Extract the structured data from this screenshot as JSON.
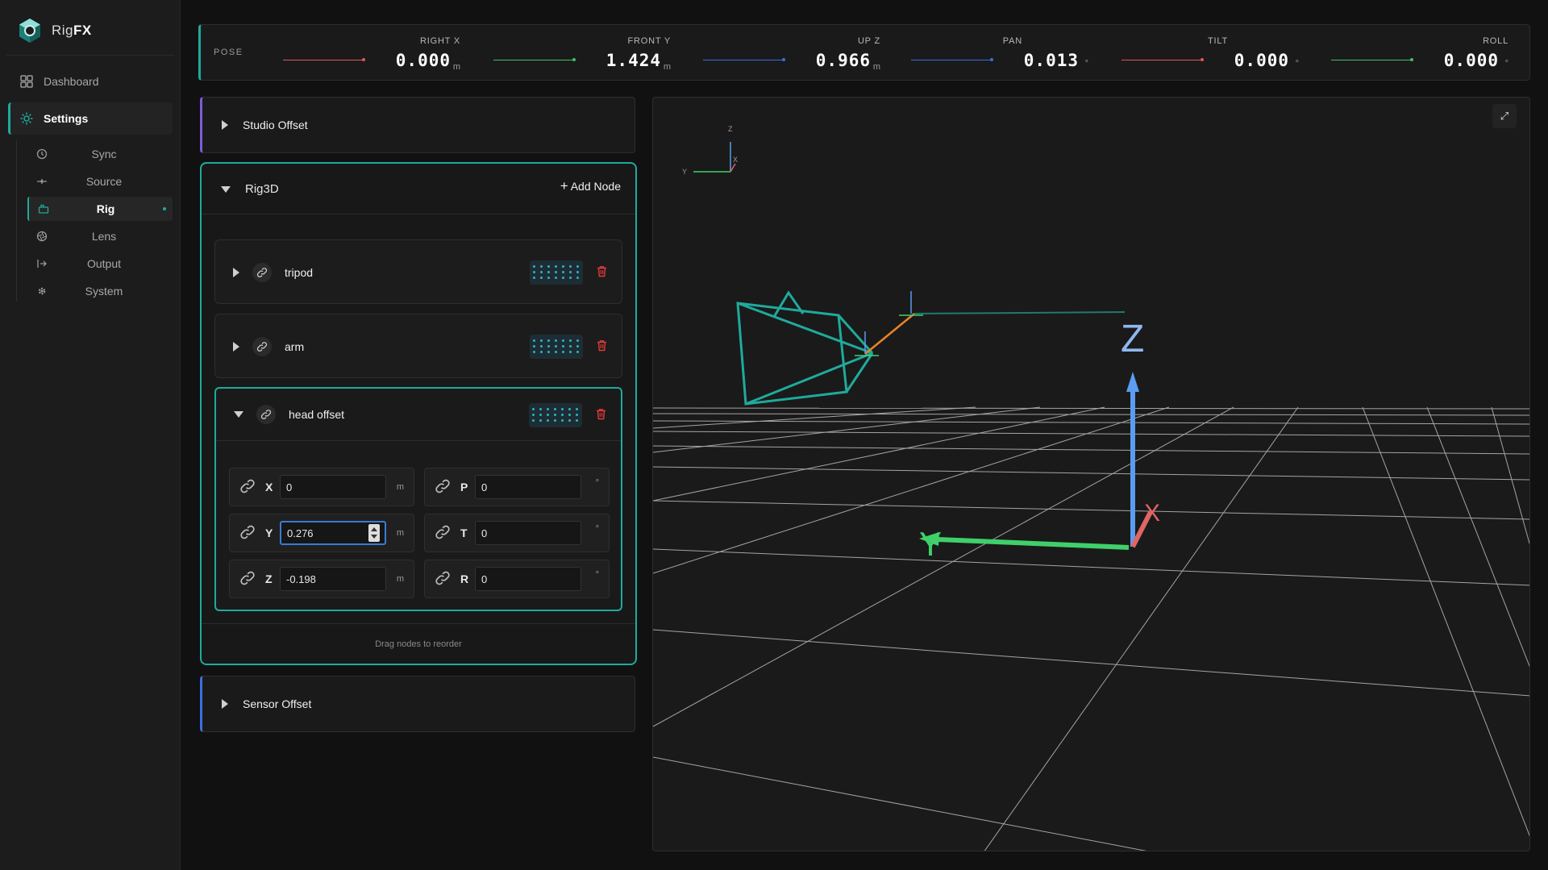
{
  "app": {
    "logo_plain": "Rig",
    "logo_bold": "FX"
  },
  "sidebar": {
    "dashboard": "Dashboard",
    "settings": "Settings",
    "sub_items": [
      {
        "label": "Sync",
        "icon": "clock-icon"
      },
      {
        "label": "Source",
        "icon": "source-icon"
      },
      {
        "label": "Rig",
        "icon": "camera-rig-icon",
        "active": true
      },
      {
        "label": "Lens",
        "icon": "aperture-icon"
      },
      {
        "label": "Output",
        "icon": "output-icon"
      },
      {
        "label": "System",
        "icon": "gear-icon"
      }
    ]
  },
  "pose": {
    "label": "POSE",
    "items": [
      {
        "label": "RIGHT X",
        "value": "0.000",
        "unit": "m",
        "color": "#e05555"
      },
      {
        "label": "FRONT Y",
        "value": "1.424",
        "unit": "m",
        "color": "#3fbf6a"
      },
      {
        "label": "UP Z",
        "value": "0.966",
        "unit": "m",
        "color": "#3b6fe0"
      },
      {
        "label": "PAN",
        "value": "0.013",
        "unit": "°",
        "color": "#3b6fe0"
      },
      {
        "label": "TILT",
        "value": "0.000",
        "unit": "°",
        "color": "#e05555"
      },
      {
        "label": "ROLL",
        "value": "0.000",
        "unit": "°",
        "color": "#3fbf6a"
      }
    ]
  },
  "panels": {
    "studio_offset": "Studio Offset",
    "sensor_offset": "Sensor Offset"
  },
  "rig3d": {
    "title": "Rig3D",
    "add_node": "Add Node",
    "nodes": [
      {
        "name": "tripod"
      },
      {
        "name": "arm"
      },
      {
        "name": "head offset"
      }
    ],
    "head_fields": {
      "x": {
        "axis": "X",
        "value": "0",
        "unit": "m"
      },
      "y": {
        "axis": "Y",
        "value": "0.276",
        "unit": "m"
      },
      "z": {
        "axis": "Z",
        "value": "-0.198",
        "unit": "m"
      },
      "p": {
        "axis": "P",
        "value": "0",
        "unit": "°"
      },
      "t": {
        "axis": "T",
        "value": "0",
        "unit": "°"
      },
      "r": {
        "axis": "R",
        "value": "0",
        "unit": "°"
      }
    },
    "footer": "Drag nodes to reorder"
  },
  "viewport": {
    "gizmo_labels": {
      "z": "Z",
      "y": "Y",
      "x": "X"
    },
    "axis_labels": {
      "z": "Z",
      "y": "Y",
      "x": "X"
    },
    "expand_icon": "expand-icon"
  },
  "colors": {
    "accent": "#1faa9c",
    "axis_x": "#e06565",
    "axis_y": "#3fd06a",
    "axis_z": "#5b9cf0",
    "studio": "#7b5cd6",
    "sensor": "#3b6fe0",
    "delete": "#e03a3a"
  }
}
